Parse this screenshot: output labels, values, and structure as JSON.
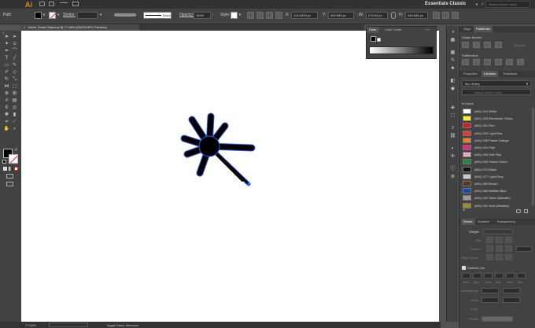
{
  "app": {
    "logo": "Ai",
    "workspace": "Essentials Classic",
    "stock_placeholder": "Search Adobe Stock"
  },
  "control_bar": {
    "selection_type": "Path",
    "stroke_label": "Stroke:",
    "brush_label": "Basic",
    "opacity_label": "Opacity:",
    "opacity_value": "100%",
    "style_label": "Style:",
    "x_label": "X:",
    "x_value": "1214.829 px",
    "y_label": "Y:",
    "y_value": "494.593 px",
    "w_label": "W:",
    "w_value": "276.54 px",
    "h_label": "H:",
    "h_value": "284.645 px"
  },
  "document": {
    "tab_title": "Vector Smart Object.ai @ 77.04% (CMYK/GPU Preview)",
    "close": "×"
  },
  "statusbar": {
    "zoom": "77.04%",
    "tool": "Toggle Direct Selection"
  },
  "color_panel": {
    "tab1": "Color",
    "tab2": "Color Guide",
    "menu": ">>"
  },
  "pathfinder_panel": {
    "tab1": "Align",
    "tab2": "Pathfinder",
    "shape_modes": "Shape Modes:",
    "expand": "Expand",
    "pathfinders": "Pathfinders:"
  },
  "libraries_panel": {
    "tab1": "Properties",
    "tab2": "Libraries",
    "tab3": "Transform",
    "library_name": "My Library",
    "search_placeholder": "Search Adobe Stock",
    "group": "Colors",
    "colors": [
      {
        "name": "(661) 010 White",
        "hex": "#ffffff"
      },
      {
        "name": "(661) 025 Brimstone Yellow",
        "hex": "#f4ee2a"
      },
      {
        "name": "(661) 031 Red",
        "hex": "#d61f25"
      },
      {
        "name": "(661) 032 Light Red",
        "hex": "#e8372d"
      },
      {
        "name": "(661) 035 Pastel Orange",
        "hex": "#ef7d22"
      },
      {
        "name": "(661) 041 Pink",
        "hex": "#e3287f"
      },
      {
        "name": "(661) 045 Soft Pink",
        "hex": "#f1a7c7"
      },
      {
        "name": "(661) 054 Yellow Green",
        "hex": "#1f8b37"
      },
      {
        "name": "(661) 070 Black",
        "hex": "#111111"
      },
      {
        "name": "(661) 077 Light Grey",
        "hex": "#c9c9c9"
      },
      {
        "name": "(661) 080 Brown",
        "hex": "#5a3321"
      },
      {
        "name": "(661) 088 Brilliant Blue",
        "hex": "#1d43b8"
      },
      {
        "name": "(661) 090 Silver (Metallic)",
        "hex": "#9a9a9a"
      },
      {
        "name": "(661) 091 Gold (Metallic)",
        "hex": "#a5852e"
      }
    ]
  },
  "stroke_panel": {
    "tab1": "Stroke",
    "tab2": "Gradient",
    "tab3": "Transparency",
    "weight_label": "Weight:",
    "cap_label": "Cap:",
    "corner_label": "Corner:",
    "align_label": "Align Stroke:",
    "dashed_label": "Dashed Line",
    "dash_labels": [
      "dash",
      "gap",
      "dash",
      "gap",
      "dash",
      "gap"
    ],
    "arrowheads_label": "Arrowheads:",
    "scale_label": "Scale:",
    "align2_label": "Align:",
    "profile_label": "Profile:"
  }
}
